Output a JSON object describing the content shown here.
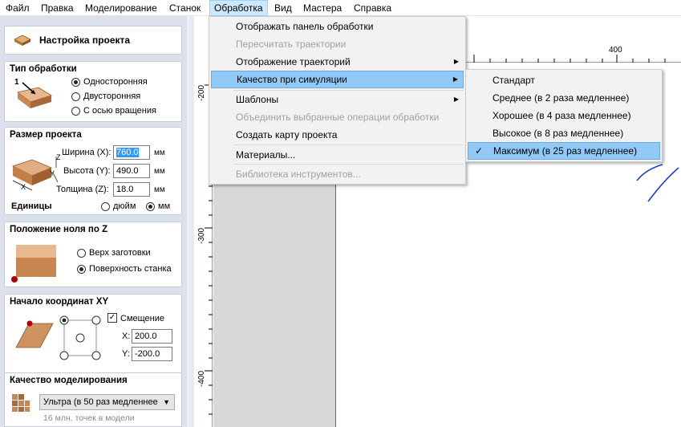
{
  "menubar": [
    "Файл",
    "Правка",
    "Моделирование",
    "Станок",
    "Обработка",
    "Вид",
    "Мастера",
    "Справка"
  ],
  "panel": {
    "title": "Настройка проекта",
    "type": {
      "title": "Тип обработки",
      "options": [
        "Односторонняя",
        "Двусторонняя",
        "С осью вращения"
      ],
      "selected": 0,
      "illustration_label": "1"
    },
    "size": {
      "title": "Размер проекта",
      "width_label": "Ширина (X):",
      "width": "760.0",
      "height_label": "Высота (Y):",
      "height": "490.0",
      "thickness_label": "Толщина (Z):",
      "thickness": "18.0",
      "unit": "мм",
      "units_label": "Единицы",
      "unit_options": [
        "дюйм",
        "мм"
      ],
      "unit_selected": 1,
      "axis_x": "X",
      "axis_y": "Y",
      "axis_z": "Z"
    },
    "zero": {
      "title": "Положение ноля по Z",
      "options": [
        "Верх заготовки",
        "Поверхность станка"
      ],
      "selected": 1
    },
    "origin": {
      "title": "Начало координат XY",
      "offset_label": "Смещение",
      "x_label": "X:",
      "x": "200.0",
      "y_label": "Y:",
      "y": "-200.0"
    },
    "quality": {
      "title": "Качество моделирования",
      "value": "Ультра (в 50 раз медленнее",
      "note": "16 млн. точек в модели"
    }
  },
  "rulers": {
    "h_400": "400",
    "v": [
      "-200",
      "-300",
      "-400"
    ]
  },
  "menu": {
    "items": [
      "Отображать панель обработки",
      "Пересчитать траектории",
      "Отображение траекторий",
      "Качество при симуляции",
      "Шаблоны",
      "Объединить выбранные операции обработки",
      "Создать карту проекта",
      "Материалы...",
      "Библиотека инструментов..."
    ]
  },
  "submenu": {
    "items": [
      "Стандарт",
      "Среднее (в 2 раза медленнее)",
      "Хорошее (в 4 раза медленнее)",
      "Высокое (в 8 раз медленнее)",
      "Максимум (в 25 раз медленнее)"
    ],
    "checked": 4
  },
  "colors": {
    "menu_highlight": "#91c9f7",
    "panel_bg": "#dbe2ee",
    "sketch_blue": "#1a3fd6"
  }
}
